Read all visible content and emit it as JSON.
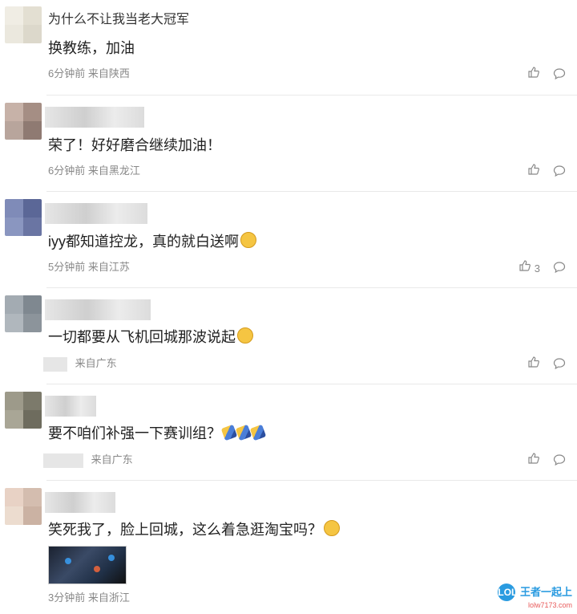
{
  "comments": [
    {
      "name": "为什么不让我当老大冠军",
      "text": "换教练，加油",
      "time": "6分钟前",
      "location": "来自陕西",
      "likes": "",
      "avatar_colors": [
        "#f0ede4",
        "#e3dfd2",
        "#ebe8de",
        "#dcd8cb"
      ]
    },
    {
      "name": "",
      "text": "荣了！好好磨合继续加油！",
      "time": "6分钟前",
      "location": "来自黑龙江",
      "likes": "",
      "avatar_colors": [
        "#c7b2a8",
        "#a58e84",
        "#b8a59c",
        "#8f7a72"
      ]
    },
    {
      "name": "",
      "text": "iyy都知道控龙，真的就白送啊",
      "time": "5分钟前",
      "location": "来自江苏",
      "likes": "3",
      "avatar_colors": [
        "#7f8bb8",
        "#5b6797",
        "#8a96c0",
        "#6a75a3"
      ]
    },
    {
      "name": "",
      "text": "一切都要从飞机回城那波说起",
      "time": "",
      "location": "来自广东",
      "likes": "",
      "avatar_colors": [
        "#a3abb2",
        "#7f8890",
        "#b0b7bd",
        "#8c949b"
      ]
    },
    {
      "name": "",
      "text": "要不咱们补强一下赛训组？",
      "time": "",
      "location": "来自广东",
      "likes": "",
      "avatar_colors": [
        "#9d9a8a",
        "#7c7a6b",
        "#a9a696",
        "#6e6c5e"
      ]
    },
    {
      "name": "",
      "text": "笑死我了，脸上回城，这么着急逛淘宝吗？",
      "time": "3分钟前",
      "location": "来自浙江",
      "likes": "",
      "avatar_colors": [
        "#e8d2c5",
        "#d4bdaf",
        "#ecdccf",
        "#cbb2a3"
      ]
    }
  ],
  "icons": {
    "like": "thumbs-up-icon",
    "reply": "comment-bubble-icon"
  },
  "watermark": {
    "logo": "LOL",
    "text": "王者一起上",
    "sub": "lolw7173.com"
  }
}
